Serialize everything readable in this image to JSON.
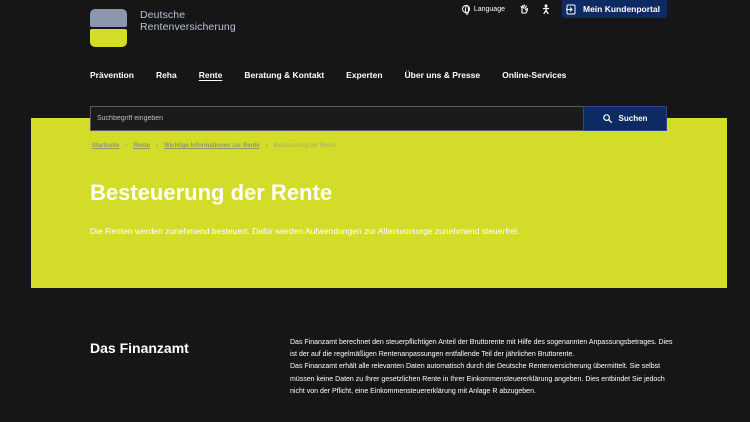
{
  "header": {
    "logo_line1": "Deutsche",
    "logo_line2": "Rentenversicherung",
    "language_label": "Language",
    "sign_language_icon": "hand-icon",
    "easy_language_icon": "easy-language-icon",
    "kundenportal_label": "Mein Kundenportal"
  },
  "nav": {
    "items": [
      {
        "label": "Prävention"
      },
      {
        "label": "Reha"
      },
      {
        "label": "Rente"
      },
      {
        "label": "Beratung & Kontakt"
      },
      {
        "label": "Experten"
      },
      {
        "label": "Über uns & Presse"
      },
      {
        "label": "Online-Services"
      }
    ],
    "active_index": 2
  },
  "search": {
    "placeholder": "Suchbegriff eingeben",
    "value": "",
    "button_label": "Suchen"
  },
  "breadcrumb": {
    "items": [
      "Startseite",
      "Rente",
      "Wichtige Informationen zur Rente",
      "Besteuerung der Rente"
    ]
  },
  "hero": {
    "title": "Besteuerung der Rente",
    "text": "Die Renten werden zunehmend besteuert. Dafür werden Aufwendungen zur Altersvorsorge zunehmend steuerfrei."
  },
  "section": {
    "title": "Das Finanzamt",
    "paragraph1": "Das Finanzamt berechnet den steuerpflichtigen Anteil der Bruttorente mit Hilfe des sogenannten Anpassungsbetrages. Dies ist der auf die regelmäßigen Rentenanpassungen entfallende Teil der jährlichen Bruttorente.",
    "paragraph2": "Das Finanzamt erhält alle relevanten Daten automatisch durch die Deutsche Rentenversicherung übermittelt. Sie selbst müssen keine Daten zu Ihrer gesetzlichen Rente in Ihrer Einkommensteuererklärung angeben. Dies entbindet Sie jedoch nicht von der Pflicht, eine Einkommensteuererklärung mit Anlage R abzugeben."
  },
  "colors": {
    "background": "#161616",
    "hero": "#d4dc2a",
    "accent_blue": "#0e2a63",
    "logo_blue": "#8a97ad"
  }
}
